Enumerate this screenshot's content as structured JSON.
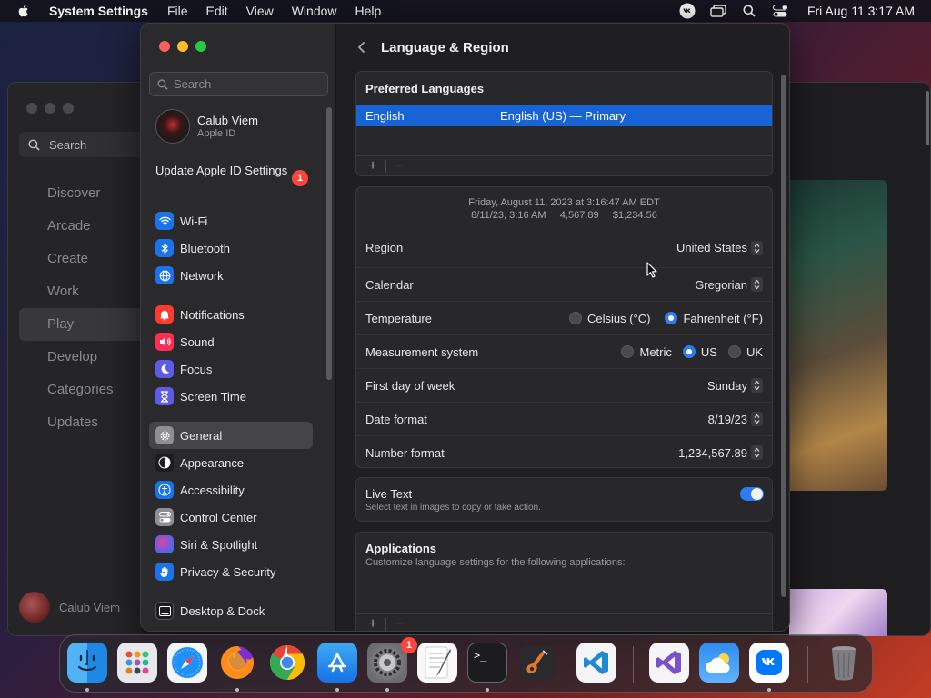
{
  "menubar": {
    "app_name": "System Settings",
    "menus": [
      "File",
      "Edit",
      "View",
      "Window",
      "Help"
    ],
    "clock": "Fri Aug 11  3:17 AM"
  },
  "background_app": {
    "search_label": "Search",
    "nav": [
      "Discover",
      "Arcade",
      "Create",
      "Work",
      "Play",
      "Develop",
      "Categories",
      "Updates"
    ],
    "active_nav": "Play",
    "user_name": "Calub Viem"
  },
  "sidebar": {
    "search_placeholder": "Search",
    "profile": {
      "name": "Calub Viem",
      "subtitle": "Apple ID"
    },
    "update": {
      "label": "Update Apple ID Settings",
      "badge": "1"
    },
    "groups": [
      [
        {
          "label": "Wi-Fi",
          "icon": "wifi-icon",
          "color": "#1a73e8"
        },
        {
          "label": "Bluetooth",
          "icon": "bluetooth-icon",
          "color": "#1a73e8"
        },
        {
          "label": "Network",
          "icon": "globe-icon",
          "color": "#1a73e8"
        }
      ],
      [
        {
          "label": "Notifications",
          "icon": "bell-icon",
          "color": "#ff3b30"
        },
        {
          "label": "Sound",
          "icon": "speaker-icon",
          "color": "#ff2d55"
        },
        {
          "label": "Focus",
          "icon": "moon-icon",
          "color": "#5e5ce6"
        },
        {
          "label": "Screen Time",
          "icon": "hourglass-icon",
          "color": "#5e5ce6"
        }
      ],
      [
        {
          "label": "General",
          "icon": "gear-icon",
          "color": "#8e8e93",
          "active": true
        },
        {
          "label": "Appearance",
          "icon": "appearance-icon",
          "color": "#1c1c1e"
        },
        {
          "label": "Accessibility",
          "icon": "accessibility-icon",
          "color": "#1a73e8"
        },
        {
          "label": "Control Center",
          "icon": "toggles-icon",
          "color": "#8e8e93"
        },
        {
          "label": "Siri & Spotlight",
          "icon": "siri-icon",
          "color": "#8e44ad"
        },
        {
          "label": "Privacy & Security",
          "icon": "hand-icon",
          "color": "#1a73e8"
        }
      ],
      [
        {
          "label": "Desktop & Dock",
          "icon": "dock-icon",
          "color": "#1c1c1e"
        }
      ]
    ]
  },
  "content": {
    "title": "Language & Region",
    "preferred_languages": {
      "title": "Preferred Languages",
      "rows": [
        {
          "language": "English",
          "detail": "English (US) — Primary"
        }
      ],
      "add": "+",
      "remove": "−"
    },
    "format_preview": {
      "line1": "Friday, August 11, 2023 at 3:16:47 AM EDT",
      "line2": "8/11/23, 3:16 AM     4,567.89     $1,234.56"
    },
    "settings": {
      "region": {
        "label": "Region",
        "value": "United States"
      },
      "calendar": {
        "label": "Calendar",
        "value": "Gregorian"
      },
      "temperature": {
        "label": "Temperature",
        "options": [
          "Celsius (°C)",
          "Fahrenheit (°F)"
        ],
        "selected": "Fahrenheit (°F)"
      },
      "measurement": {
        "label": "Measurement system",
        "options": [
          "Metric",
          "US",
          "UK"
        ],
        "selected": "US"
      },
      "first_day": {
        "label": "First day of week",
        "value": "Sunday"
      },
      "date_format": {
        "label": "Date format",
        "value": "8/19/23"
      },
      "number_format": {
        "label": "Number format",
        "value": "1,234,567.89"
      }
    },
    "live_text": {
      "title": "Live Text",
      "subtitle": "Select text in images to copy or take action.",
      "enabled": true
    },
    "applications": {
      "title": "Applications",
      "subtitle": "Customize language settings for the following applications:",
      "add": "+",
      "remove": "−"
    }
  },
  "dock": {
    "apps": [
      {
        "name": "Finder",
        "icon": "finder-icon",
        "running": true
      },
      {
        "name": "Launchpad",
        "icon": "launchpad-icon",
        "running": false
      },
      {
        "name": "Safari",
        "icon": "safari-icon",
        "running": false
      },
      {
        "name": "Firefox",
        "icon": "firefox-icon",
        "running": true
      },
      {
        "name": "Chrome",
        "icon": "chrome-icon",
        "running": false
      },
      {
        "name": "App Store",
        "icon": "app-store-icon",
        "running": true
      },
      {
        "name": "System Settings",
        "icon": "settings-icon",
        "running": true,
        "badge": "1"
      },
      {
        "name": "TextEdit",
        "icon": "textedit-icon",
        "running": false
      },
      {
        "name": "Terminal",
        "icon": "terminal-icon",
        "running": true
      },
      {
        "name": "GarageBand",
        "icon": "garageband-icon",
        "running": false
      },
      {
        "name": "VS Code",
        "icon": "vscode-icon",
        "running": false
      },
      {
        "name": "Visual Studio",
        "icon": "visual-studio-icon",
        "running": false
      },
      {
        "name": "Weather",
        "icon": "weather-icon",
        "running": false
      },
      {
        "name": "VK",
        "icon": "vk-icon",
        "running": true
      },
      {
        "name": "Trash",
        "icon": "trash-icon",
        "running": false
      }
    ],
    "terminal_prompt": ">_"
  }
}
